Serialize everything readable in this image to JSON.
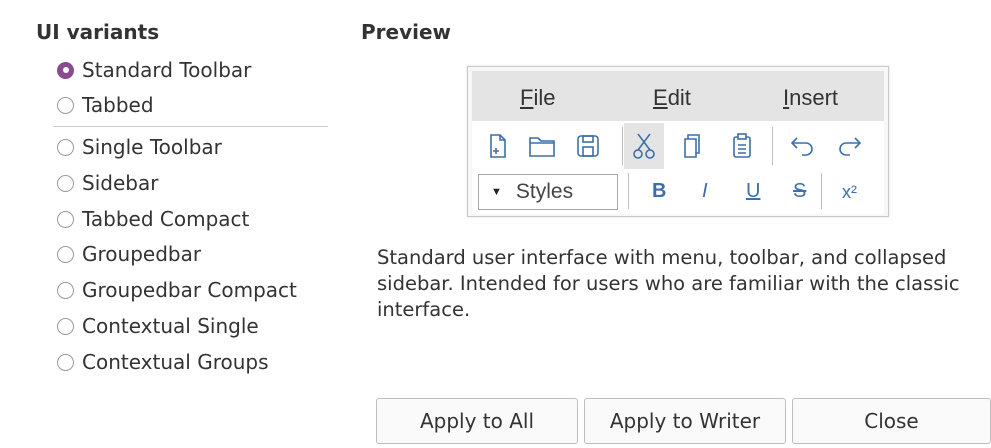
{
  "left_title": "UI variants",
  "right_title": "Preview",
  "variants": [
    {
      "label": "Standard Toolbar",
      "checked": true
    },
    {
      "label": "Tabbed",
      "checked": false
    },
    {
      "label": "Single Toolbar",
      "checked": false
    },
    {
      "label": "Sidebar",
      "checked": false
    },
    {
      "label": "Tabbed Compact",
      "checked": false
    },
    {
      "label": "Groupedbar",
      "checked": false
    },
    {
      "label": "Groupedbar Compact",
      "checked": false
    },
    {
      "label": "Contextual Single",
      "checked": false
    },
    {
      "label": "Contextual Groups",
      "checked": false
    }
  ],
  "preview": {
    "menu": [
      {
        "mnemonic": "F",
        "rest": "ile"
      },
      {
        "mnemonic": "E",
        "rest": "dit"
      },
      {
        "mnemonic": "I",
        "rest": "nsert"
      }
    ],
    "styles_label": "Styles",
    "format_buttons": [
      "B",
      "I",
      "U",
      "S",
      "x²"
    ],
    "colors": {
      "icon": "#3d6fa8",
      "menubar": "#e4e4e4"
    }
  },
  "description": "Standard user interface with menu, toolbar, and collapsed sidebar. Intended for users who are familiar with the classic interface.",
  "buttons": {
    "apply_all": "Apply to All",
    "apply_writer": "Apply to Writer",
    "close": "Close"
  },
  "colors": {
    "accent": "#8a4a8e"
  }
}
